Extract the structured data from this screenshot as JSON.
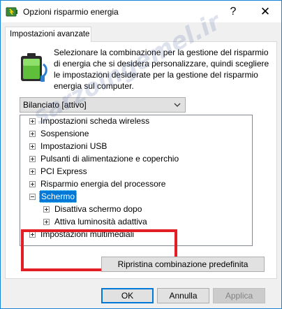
{
  "window": {
    "title": "Opzioni risparmio energia",
    "help_glyph": "?",
    "close_glyph": "✕"
  },
  "tab": {
    "label": "Impostazioni avanzate"
  },
  "description": "Selezionare la combinazione per la gestione del risparmio di energia che si desidera personalizzare, quindi scegliere le impostazioni desiderate per la gestione del risparmio energia sul computer.",
  "plan_select": {
    "value": "Bilanciato [attivo]"
  },
  "tree": {
    "items": [
      {
        "label": "Impostazioni scheda wireless",
        "expander": "+"
      },
      {
        "label": "Sospensione",
        "expander": "+"
      },
      {
        "label": "Impostazioni USB",
        "expander": "+"
      },
      {
        "label": "Pulsanti di alimentazione e coperchio",
        "expander": "+"
      },
      {
        "label": "PCI Express",
        "expander": "+"
      },
      {
        "label": "Risparmio energia del processore",
        "expander": "+"
      },
      {
        "label": "Schermo",
        "expander": "-",
        "selected": true
      },
      {
        "label": "Disattiva schermo dopo",
        "expander": "+",
        "child": true
      },
      {
        "label": "Attiva luminosità adattiva",
        "expander": "+",
        "child": true
      },
      {
        "label": "Impostazioni multimediali",
        "expander": "+"
      }
    ]
  },
  "buttons": {
    "restore": "Ripristina combinazione predefinita",
    "ok": "OK",
    "cancel": "Annulla",
    "apply": "Applica"
  },
  "watermark": "sarzoingemel.ir",
  "colors": {
    "selection": "#0078d7",
    "highlight_box": "#e31e24",
    "window_border": "#1883d7"
  }
}
